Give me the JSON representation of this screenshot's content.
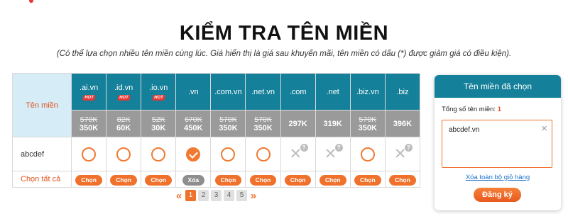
{
  "header": {
    "title": "KIỂM TRA TÊN MIỀN",
    "subtitle": "(Có thể lựa chọn nhiều tên miền cùng lúc. Giá hiển thị là giá sau khuyến mãi, tên miền có dấu (*) được giảm giá có điều kiện)."
  },
  "table": {
    "label_header": "Tên miền",
    "domain_name": "abcdef",
    "select_all_label": "Chọn tất cả",
    "hot_label": "HOT",
    "columns": [
      {
        "ext": ".ai.vn",
        "hot": true,
        "old_price": "570K",
        "new_price": "350K",
        "status": "available",
        "action": "Chọn"
      },
      {
        "ext": ".id.vn",
        "hot": true,
        "old_price": "82K",
        "new_price": "60K",
        "status": "available",
        "action": "Chọn"
      },
      {
        "ext": ".io.vn",
        "hot": true,
        "old_price": "52K",
        "new_price": "30K",
        "status": "available",
        "action": "Chọn"
      },
      {
        "ext": ".vn",
        "hot": false,
        "old_price": "670K",
        "new_price": "450K",
        "status": "selected",
        "action": "Xóa"
      },
      {
        "ext": ".com.vn",
        "hot": false,
        "old_price": "570K",
        "new_price": "350K",
        "status": "available",
        "action": "Chọn"
      },
      {
        "ext": ".net.vn",
        "hot": false,
        "old_price": "570K",
        "new_price": "350K",
        "status": "available",
        "action": "Chọn"
      },
      {
        "ext": ".com",
        "hot": false,
        "old_price": "",
        "new_price": "297K",
        "status": "taken",
        "action": "Chọn"
      },
      {
        "ext": ".net",
        "hot": false,
        "old_price": "",
        "new_price": "319K",
        "status": "taken",
        "action": "Chọn"
      },
      {
        "ext": ".biz.vn",
        "hot": false,
        "old_price": "570K",
        "new_price": "350K",
        "status": "available",
        "action": "Chọn"
      },
      {
        "ext": ".biz",
        "hot": false,
        "old_price": "",
        "new_price": "396K",
        "status": "taken",
        "action": "Chọn"
      }
    ]
  },
  "pagination": {
    "prev": "«",
    "next": "»",
    "pages": [
      "1",
      "2",
      "3",
      "4",
      "5"
    ],
    "current": "1"
  },
  "cart": {
    "title": "Tên miền đã chọn",
    "count_label": "Tổng số tên miền:",
    "count": "1",
    "items": [
      "abcdef.vn"
    ],
    "remove_icon": "×",
    "clear_label": "Xóa toàn bộ giỏ hàng",
    "register_label": "Đăng ký"
  },
  "colors": {
    "accent": "#f0712c",
    "header_teal": "#15809a",
    "label_bg": "#d6ecf7",
    "price_bg": "#9a9a9a",
    "link": "#1a73c9"
  }
}
